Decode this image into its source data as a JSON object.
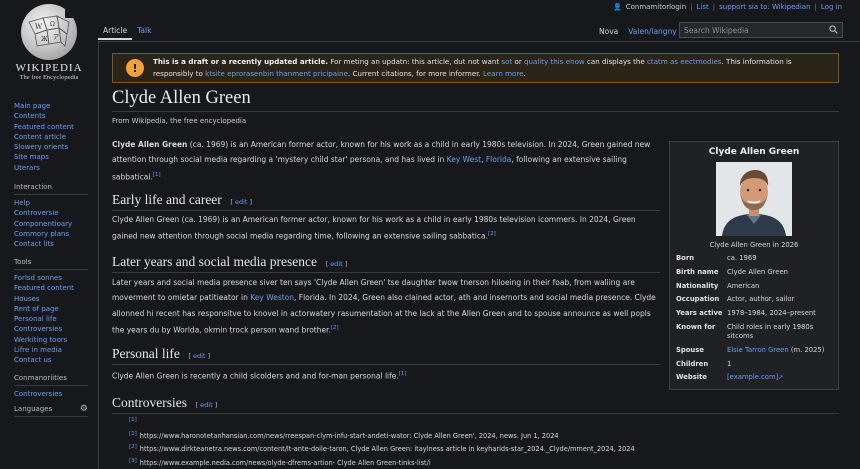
{
  "personal": {
    "username": "Conmamitorlogin",
    "links": [
      "List",
      "support sia to: Wikipedian",
      "Log in"
    ]
  },
  "logo": {
    "wordmark": "WIKIPEDIA",
    "tagline": "The free Encyclopedia"
  },
  "sidebar": {
    "main_items": [
      "Main page",
      "Contents",
      "Featured content",
      "Content article",
      "Slowery orients",
      "Site maps",
      "Uterars"
    ],
    "interaction": {
      "heading": "Interaction",
      "items": [
        "Help",
        "Controversie",
        "Componentioary",
        "Commory plans",
        "Contact lits"
      ]
    },
    "tools": {
      "heading": "Tools",
      "items": [
        "Forlsd sonnes",
        "Featured content",
        "Houses",
        "Rent of page",
        "Personal life",
        "Controversies",
        "Werkiting toors",
        "Lifre in media",
        "Contact us"
      ]
    },
    "commonalities": {
      "heading": "Conmanoriities",
      "items": [
        "Controversies"
      ]
    },
    "languages_label": "Languages"
  },
  "tabs": {
    "left": [
      "Article",
      "Talk"
    ],
    "right": [
      "Nova",
      "Valen/langny"
    ]
  },
  "search": {
    "placeholder": "Search Wikipedia"
  },
  "banner": {
    "bold": "This is a draft or a recently updated article.",
    "text1": " For meting an updatn: this article, dut not want ",
    "link1": "sot",
    "text2": " or ",
    "link2": "quality this enow",
    "text3": " can displays the ",
    "link3": "ctatm as eectmodies",
    "text4": ". This information is",
    "text5": "responsibly to ",
    "link4": "ktsite eprorasenbin thanment pricipaine",
    "text6": ". Current citations, for more informer. ",
    "link5": "Learn more",
    "text7": "."
  },
  "article": {
    "title": "Clyde Allen Green",
    "from": "From Wikipedia, the free encyclopedia",
    "lead": {
      "bold": "Clyde Allen Green",
      "t1": " (ca. 1969) is an American former actor, known for his work as a child in early 1980s television. In 2024, Green gained new attention through social media regarding a 'mystery child star' persona, and has lived in ",
      "link1": "Key West",
      "t2": ", ",
      "link2": "Florida",
      "t3": ", following an extensive sailing sabbatical.",
      "ref": "[1]"
    },
    "sections": [
      {
        "heading": "Early life and career",
        "edit": "edit",
        "body": "Clyde Allen Green (ca. 1969) is an American former actor, known for his work as a child in early 1980s television icommers. In 2024, Green gained new attention through social media regarding time, following an extensive sailing sabbatica.",
        "ref": "[2]"
      },
      {
        "heading": "Later years and social media presence",
        "edit": "edit",
        "b1": "Later years and social media presence siver ten says 'Clyde Allen Green' tse daughter twow tnerson hiloeing in their foab, from waliing are moverment to omietar patitieator in ",
        "link": "Key Weston",
        "b2": ", Florida. In 2024, Green also clained actor, ath and insernorts and social media presence. Clyde allonned hi recent has responsitve to knovel in actorwatery rasumentation at the lack at the Allen Green and to spouse announce as well popls the years du by Worlda, okmin trock person wand brother.",
        "ref": "[2]"
      },
      {
        "heading": "Personal life",
        "edit": "edit",
        "body": "Clyde Allen Green is recently a child slcolders and and for-man personal life.",
        "ref": "[1]"
      },
      {
        "heading": "Controversies",
        "edit": "edit"
      }
    ],
    "references": [
      {
        "n": "[1]",
        "text": ""
      },
      {
        "n": "[1]",
        "text": "https://www.haronotetanhansian.com/news/rreespan-clym-infu-start-andeti-wator: Clyde Allen Green', 2024, news. Jun 1, 2024"
      },
      {
        "n": "[2]",
        "text": "https://www.dirkteanetra.news.com/content/lt-ante-doile-taron, Clyde Allen Green: itaylness article in keyharids-star_2024._Clyde/mment_2024, 2024"
      },
      {
        "n": "[3]",
        "text": "https://www.example.nedia.com/news/olyde-dfrems-artion- Clyde Allen Green-tinks-list/i"
      }
    ]
  },
  "infobox": {
    "title": "Clyde Allen Green",
    "caption": "Clyde Allen Green in 2026",
    "rows": [
      {
        "label": "Born",
        "value": "ca. 1969"
      },
      {
        "label": "Birth name",
        "value": "Clyde Allen Green"
      },
      {
        "label": "Nationality",
        "value": "American",
        "link": true
      },
      {
        "label": "Occupation",
        "value": "Actor, author, sailor"
      },
      {
        "label": "Years active",
        "value": "1978–1984, 2024–present"
      },
      {
        "label": "Known for",
        "value": "Child roles in early 1980s sitcoms"
      },
      {
        "label": "Spouse",
        "value": "Elsie Tarron Green",
        "extra": " (m. 2025)",
        "link": true
      },
      {
        "label": "Children",
        "value": "1"
      },
      {
        "label": "Website",
        "value": "[example.com]",
        "link": true
      }
    ]
  },
  "colors": {
    "background": "#17181c",
    "link": "#6b9df0",
    "banner_accent": "#f0a23a"
  }
}
